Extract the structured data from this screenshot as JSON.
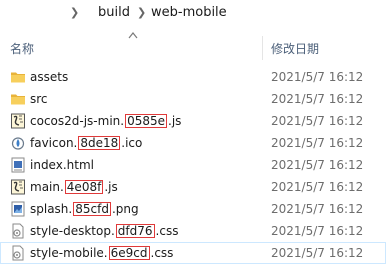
{
  "breadcrumb": {
    "items": [
      "build",
      "web-mobile"
    ]
  },
  "columns": {
    "name": "名称",
    "modified": "修改日期"
  },
  "files": [
    {
      "prefix": "assets",
      "hash": "",
      "suffix": "",
      "icon": "folder-icon",
      "date": "2021/5/7 16:12"
    },
    {
      "prefix": "src",
      "hash": "",
      "suffix": "",
      "icon": "folder-icon",
      "date": "2021/5/7 16:12"
    },
    {
      "prefix": "cocos2d-js-min.",
      "hash": "0585e",
      "suffix": ".js",
      "icon": "script-file-icon",
      "date": "2021/5/7 16:12"
    },
    {
      "prefix": "favicon.",
      "hash": "8de18",
      "suffix": ".ico",
      "icon": "favicon-file-icon",
      "date": "2021/5/7 16:12"
    },
    {
      "prefix": "index.html",
      "hash": "",
      "suffix": "",
      "icon": "html-file-icon",
      "date": "2021/5/7 16:12"
    },
    {
      "prefix": "main.",
      "hash": "4e08f",
      "suffix": ".js",
      "icon": "script-file-icon",
      "date": "2021/5/7 16:12"
    },
    {
      "prefix": "splash.",
      "hash": "85cfd",
      "suffix": ".png",
      "icon": "image-file-icon",
      "date": "2021/5/7 16:12"
    },
    {
      "prefix": "style-desktop.",
      "hash": "dfd76",
      "suffix": ".css",
      "icon": "css-file-icon",
      "date": "2021/5/7 16:12"
    },
    {
      "prefix": "style-mobile.",
      "hash": "6e9cd",
      "suffix": ".css",
      "icon": "css-file-icon",
      "date": "2021/5/7 16:12"
    }
  ],
  "colors": {
    "hash_highlight": "#e03a3a",
    "folder": "#f5c542",
    "selection_outline": "#cde8ff"
  }
}
